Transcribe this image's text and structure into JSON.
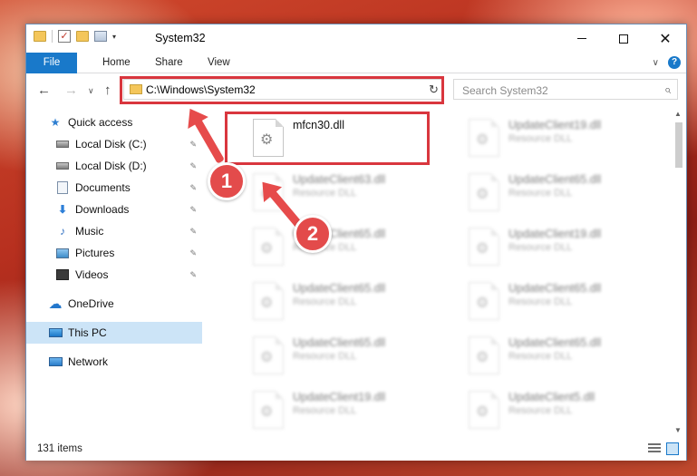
{
  "window": {
    "title": "System32",
    "controls": {
      "minimize": "—",
      "maximize": "☐",
      "close": "✕"
    }
  },
  "quick_access_toolbar": {
    "dropdown": "▾"
  },
  "ribbon": {
    "tabs": [
      {
        "label": "File",
        "active": true
      },
      {
        "label": "Home"
      },
      {
        "label": "Share"
      },
      {
        "label": "View"
      }
    ],
    "help": "?",
    "collapse": "∨"
  },
  "address_bar": {
    "path": "C:\\Windows\\System32",
    "dropdown": "∨",
    "refresh": "↻"
  },
  "search": {
    "placeholder": "Search System32",
    "icon": "search-icon"
  },
  "nav": {
    "back": "←",
    "forward": "→",
    "recent": "∨",
    "up": "↑"
  },
  "sidebar": {
    "items": [
      {
        "label": "Quick access",
        "icon": "star-icon",
        "pinned": false
      },
      {
        "label": "Local Disk (C:)",
        "icon": "drive-icon",
        "pinned": true
      },
      {
        "label": "Local Disk (D:)",
        "icon": "drive-icon",
        "pinned": true
      },
      {
        "label": "Documents",
        "icon": "documents-icon",
        "pinned": true
      },
      {
        "label": "Downloads",
        "icon": "downloads-icon",
        "pinned": true
      },
      {
        "label": "Music",
        "icon": "music-icon",
        "pinned": true
      },
      {
        "label": "Pictures",
        "icon": "pictures-icon",
        "pinned": true
      },
      {
        "label": "Videos",
        "icon": "videos-icon",
        "pinned": true
      },
      {
        "label": "OneDrive",
        "icon": "onedrive-icon",
        "pinned": false
      },
      {
        "label": "This PC",
        "icon": "this-pc-icon",
        "pinned": false,
        "selected": true
      },
      {
        "label": "Network",
        "icon": "network-icon",
        "pinned": false
      }
    ],
    "pin_glyph": "📌"
  },
  "files": [
    {
      "name": "mfcn30.dll",
      "type": ""
    },
    {
      "name": "UpdateClient19.dll",
      "type": "Resource DLL"
    },
    {
      "name": "UpdateClient63.dll",
      "type": "Resource DLL"
    },
    {
      "name": "UpdateClient65.dll",
      "type": "Resource DLL"
    },
    {
      "name": "UpdateClient65.dll",
      "type": "Resource DLL"
    },
    {
      "name": "UpdateClient19.dll",
      "type": "Resource DLL"
    },
    {
      "name": "UpdateClient65.dll",
      "type": "Resource DLL"
    },
    {
      "name": "UpdateClient65.dll",
      "type": "Resource DLL"
    },
    {
      "name": "UpdateClient65.dll",
      "type": "Resource DLL"
    },
    {
      "name": "UpdateClient65.dll",
      "type": "Resource DLL"
    },
    {
      "name": "UpdateClient19.dll",
      "type": "Resource DLL"
    },
    {
      "name": "UpdateClient5.dll",
      "type": "Resource DLL"
    }
  ],
  "status": {
    "item_count": "131 items"
  },
  "annotations": {
    "step1": "1",
    "step2": "2",
    "color": "#e34b4b"
  },
  "colors": {
    "accent": "#1979ca",
    "selection": "#cce4f7",
    "highlight": "#d9363e"
  }
}
